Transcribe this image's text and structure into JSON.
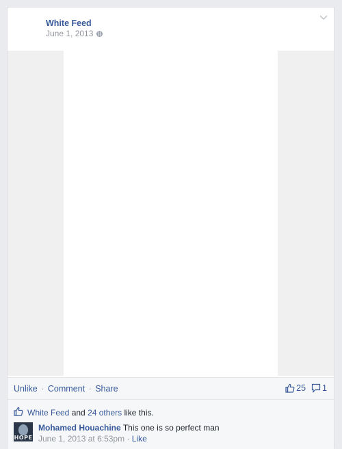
{
  "post": {
    "page_name": "White Feed",
    "date": "June 1, 2013",
    "privacy_icon": "globe-icon",
    "menu_icon": "chevron-down-icon"
  },
  "actions": {
    "unlike": "Unlike",
    "comment": "Comment",
    "share": "Share",
    "separator": "·"
  },
  "counts": {
    "likes": "25",
    "comments": "1",
    "like_icon": "thumbs-up-icon",
    "comment_icon": "comment-bubble-icon"
  },
  "likes_summary": {
    "name": "White Feed",
    "and": "and",
    "others": "24 others",
    "suffix": "like this."
  },
  "comment": {
    "author": "Mohamed Houachine",
    "text": "This one is so perfect man",
    "time": "June 1, 2013 at 6:53pm",
    "like": "Like",
    "avatar_text": "HOPE"
  },
  "colors": {
    "link": "#365899",
    "muted": "#90949c",
    "panel": "#f6f7f9",
    "media_side": "#f0f0f0"
  }
}
